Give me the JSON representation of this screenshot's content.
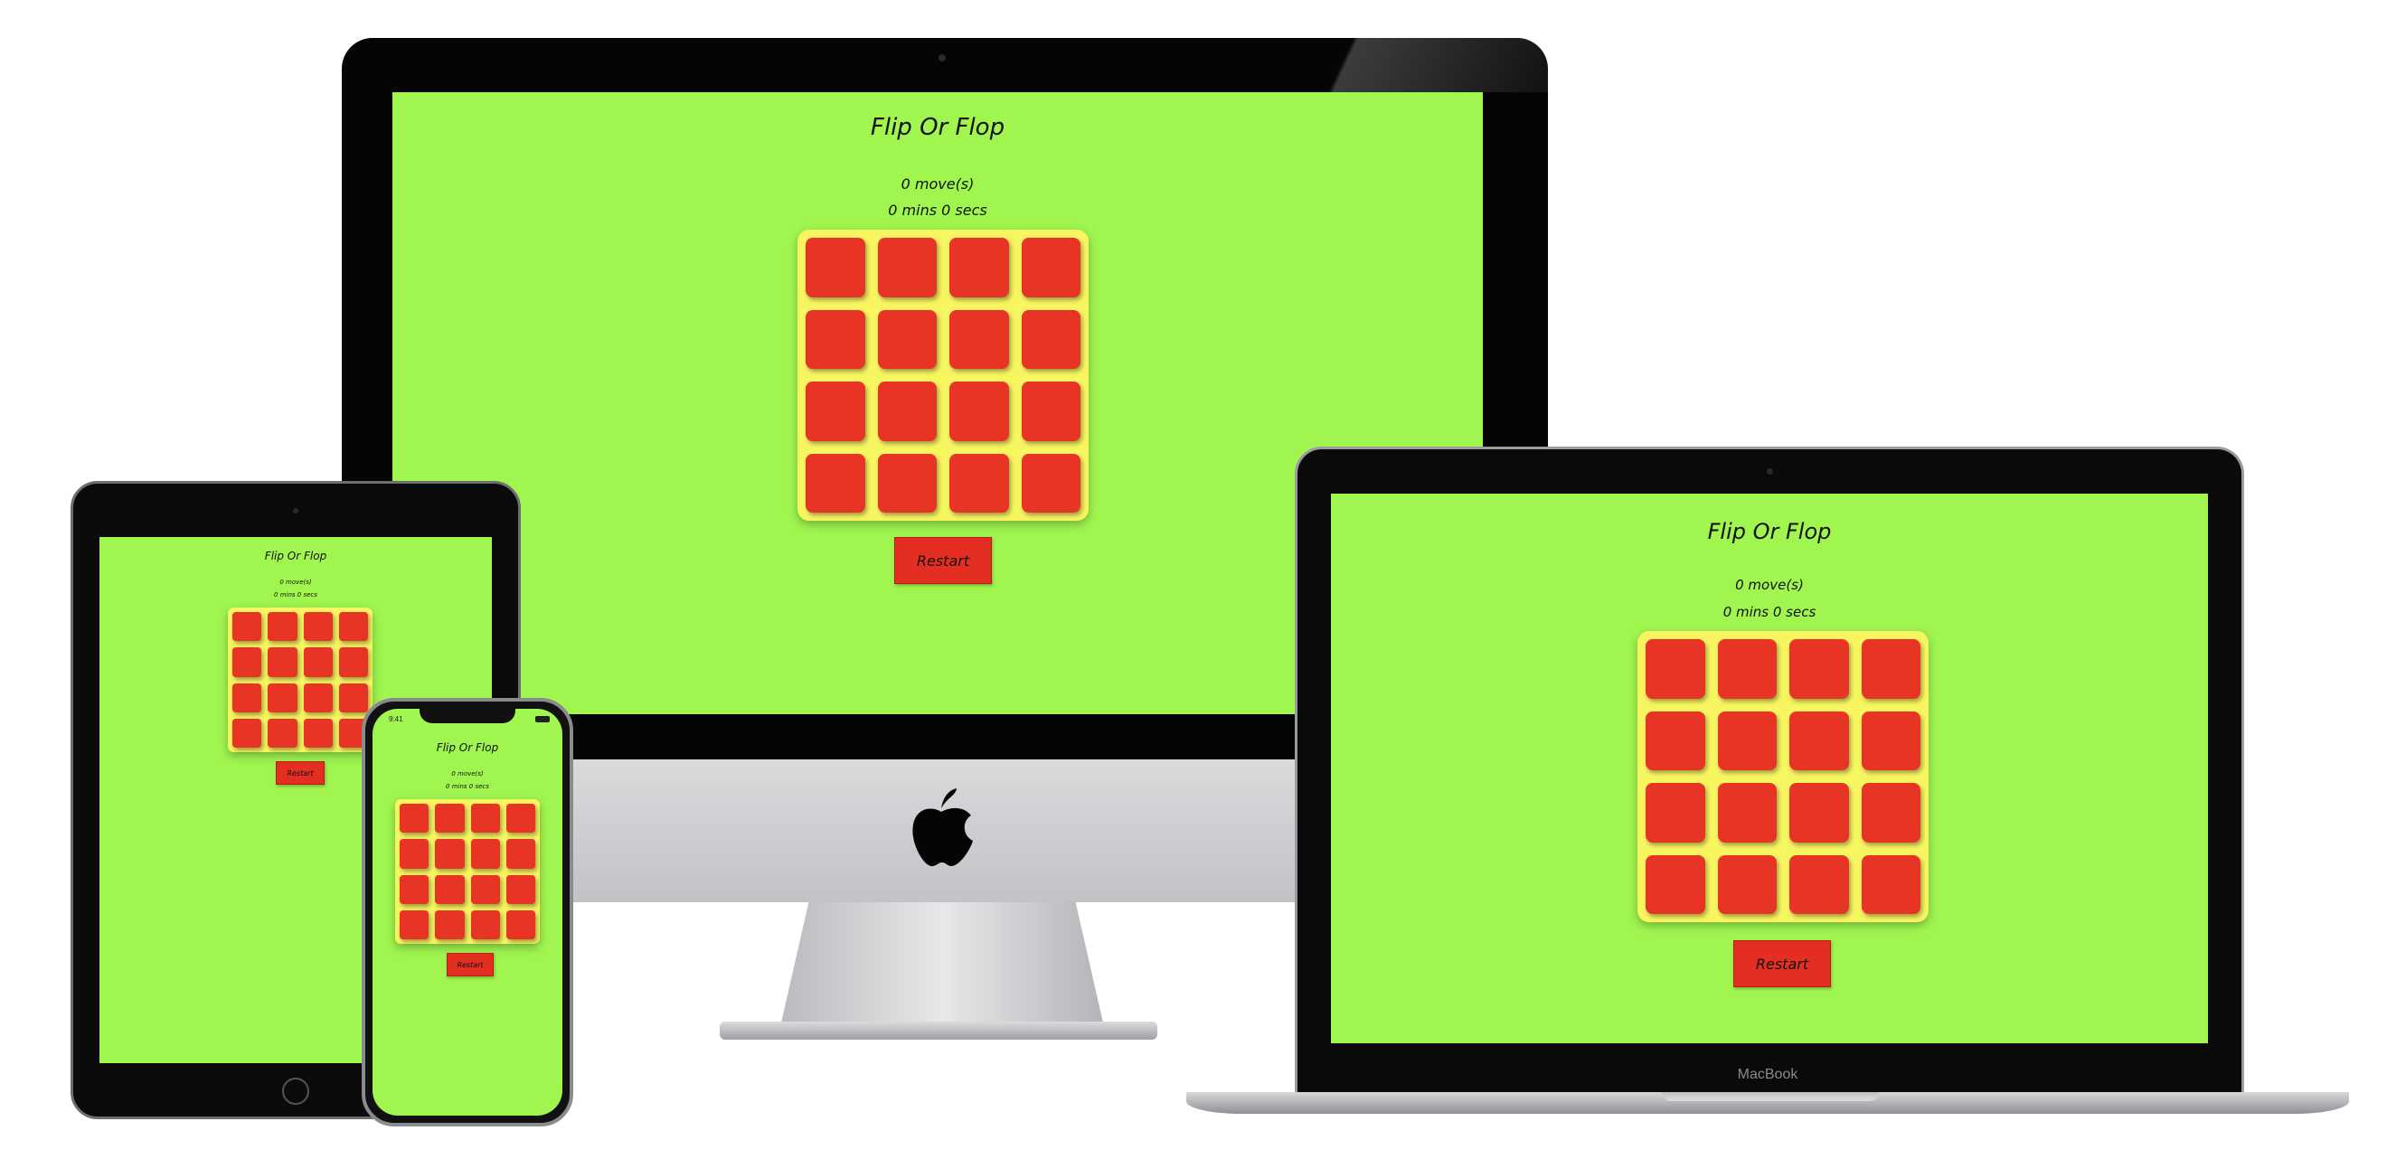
{
  "game": {
    "title": "Flip Or Flop",
    "moves": "0 move(s)",
    "timer": "0 mins 0 secs",
    "restart_label": "Restart",
    "card_count": 16
  },
  "phone": {
    "status_time": "9:41"
  },
  "laptop": {
    "brand_label": "MacBook"
  },
  "colors": {
    "background": "#a0f54f",
    "deck": "#f7f560",
    "card": "#e83424",
    "button": "#e52e22"
  }
}
